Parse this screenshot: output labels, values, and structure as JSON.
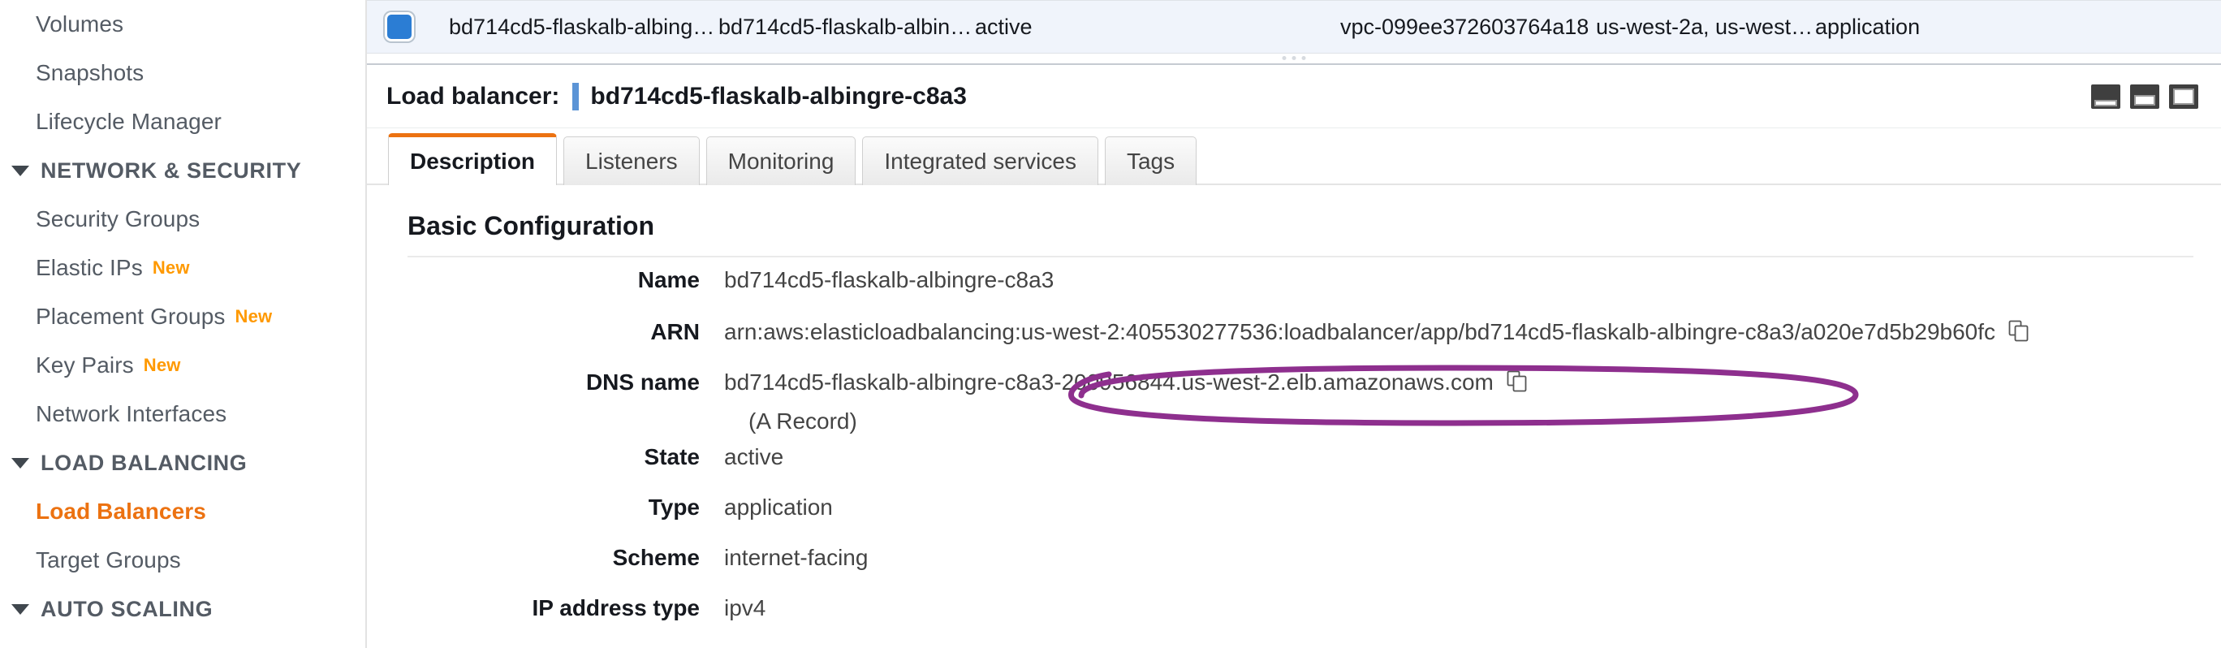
{
  "sidebar": {
    "items": [
      {
        "type": "item",
        "label": "Volumes",
        "badge": "",
        "selected": false
      },
      {
        "type": "item",
        "label": "Snapshots",
        "badge": "",
        "selected": false
      },
      {
        "type": "item",
        "label": "Lifecycle Manager",
        "badge": "",
        "selected": false
      },
      {
        "type": "section",
        "label": "NETWORK & SECURITY",
        "badge": "",
        "selected": false
      },
      {
        "type": "item",
        "label": "Security Groups",
        "badge": "",
        "selected": false
      },
      {
        "type": "item",
        "label": "Elastic IPs",
        "badge": "New",
        "selected": false
      },
      {
        "type": "item",
        "label": "Placement Groups",
        "badge": "New",
        "selected": false
      },
      {
        "type": "item",
        "label": "Key Pairs",
        "badge": "New",
        "selected": false
      },
      {
        "type": "item",
        "label": "Network Interfaces",
        "badge": "",
        "selected": false
      },
      {
        "type": "section",
        "label": "LOAD BALANCING",
        "badge": "",
        "selected": false
      },
      {
        "type": "item",
        "label": "Load Balancers",
        "badge": "",
        "selected": true
      },
      {
        "type": "item",
        "label": "Target Groups",
        "badge": "",
        "selected": false
      },
      {
        "type": "section",
        "label": "AUTO SCALING",
        "badge": "",
        "selected": false
      }
    ]
  },
  "table_row": {
    "selected": true,
    "checkbox_icon": "checkbox-checked-icon",
    "name": "bd714cd5-flaskalb-albingre-c...",
    "dns_name": "bd714cd5-flaskalb-albingre-c...",
    "state": "active",
    "vpc_id": "vpc-099ee372603764a18",
    "availability_zones": "us-west-2a, us-west-2b...",
    "type": "application"
  },
  "panel_header": {
    "title_label": "Load balancer:",
    "title_value": "bd714cd5-flaskalb-albingre-c8a3",
    "layout_buttons": [
      {
        "icon": "layout-bottom-small-icon",
        "label": "Small details pane"
      },
      {
        "icon": "layout-bottom-medium-icon",
        "label": "Medium details pane"
      },
      {
        "icon": "layout-full-icon",
        "label": "Full details pane"
      }
    ]
  },
  "tabs": [
    {
      "label": "Description",
      "active": true
    },
    {
      "label": "Listeners",
      "active": false
    },
    {
      "label": "Monitoring",
      "active": false
    },
    {
      "label": "Integrated services",
      "active": false
    },
    {
      "label": "Tags",
      "active": false
    }
  ],
  "basic_configuration": {
    "section_title": "Basic Configuration",
    "fields": [
      {
        "label": "Name",
        "value": "bd714cd5-flaskalb-albingre-c8a3",
        "copy": false,
        "sub": ""
      },
      {
        "label": "ARN",
        "value": "arn:aws:elasticloadbalancing:us-west-2:405530277536:loadbalancer/app/bd714cd5-flaskalb-albingre-c8a3/a020e7d5b29b60fc",
        "copy": true,
        "sub": ""
      },
      {
        "label": "DNS name",
        "value": "bd714cd5-flaskalb-albingre-c8a3-200956844.us-west-2.elb.amazonaws.com",
        "copy": true,
        "sub": "(A Record)"
      },
      {
        "label": "State",
        "value": "active",
        "copy": false,
        "sub": ""
      },
      {
        "label": "Type",
        "value": "application",
        "copy": false,
        "sub": ""
      },
      {
        "label": "Scheme",
        "value": "internet-facing",
        "copy": false,
        "sub": ""
      },
      {
        "label": "IP address type",
        "value": "ipv4",
        "copy": false,
        "sub": ""
      }
    ]
  },
  "annotation": {
    "shape": "ellipse",
    "target_field": "DNS name",
    "color": "#8e2f8e"
  },
  "colors": {
    "accent_orange": "#ec7211",
    "badge_orange": "#ff9900",
    "nav_text": "#545b64",
    "selected_row_bg": "#f0f4fb",
    "annotation_purple": "#8e2f8e"
  }
}
